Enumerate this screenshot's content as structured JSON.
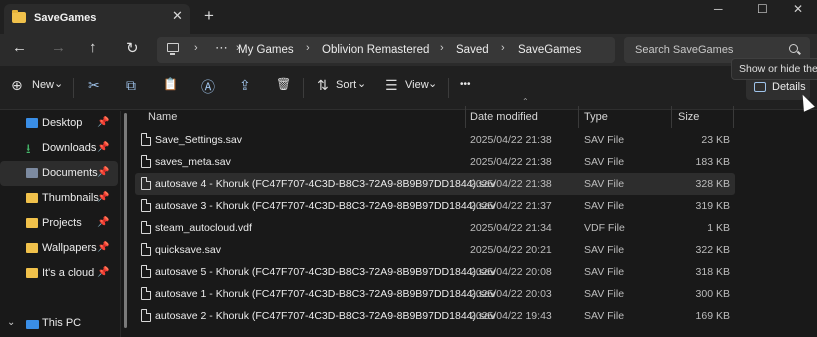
{
  "tab": {
    "title": "SaveGames",
    "close": "✕",
    "new_tab": "+"
  },
  "window": {
    "minimize": "─",
    "maximize": "☐",
    "close": "✕"
  },
  "nav": {
    "back": "←",
    "forward": "→",
    "up": "↑",
    "refresh": "↻"
  },
  "address": {
    "sep": "›",
    "dots": "⋯",
    "breadcrumbs": [
      "My Games",
      "Oblivion Remastered",
      "Saved",
      "SaveGames"
    ]
  },
  "search": {
    "placeholder": "Search SaveGames"
  },
  "commandbar": {
    "new_label": "New",
    "new_icon": "⊕",
    "dropdown": "⌄",
    "cut_icon": "✂",
    "copy_icon": "⧉",
    "paste_icon": "📋",
    "rename_icon": "Ⓐ",
    "share_icon": "⇪",
    "delete_icon": "🗑",
    "sort_icon": "⇅",
    "sort_label": "Sort",
    "view_icon": "☰",
    "view_label": "View",
    "more_icon": "•••",
    "details_label": "Details",
    "tooltip": "Show or hide the d"
  },
  "sidebar": {
    "pin": "📌",
    "items": [
      {
        "label": "Desktop",
        "icon": "desktop-icon",
        "pinned": true
      },
      {
        "label": "Downloads",
        "icon": "download-icon",
        "glyph": "⭳",
        "pinned": true
      },
      {
        "label": "Documents",
        "icon": "documents-icon",
        "pinned": true,
        "active": true
      },
      {
        "label": "Thumbnails",
        "icon": "folder-icon",
        "pinned": true
      },
      {
        "label": "Projects",
        "icon": "folder-icon",
        "pinned": true
      },
      {
        "label": "Wallpapers",
        "icon": "folder-icon",
        "pinned": true
      },
      {
        "label": "It's a cloud",
        "icon": "folder-icon",
        "pinned": true
      }
    ],
    "this_pc": {
      "label": "This PC",
      "chevron": "⌄"
    }
  },
  "list": {
    "sort_arrow": "⌃",
    "columns": [
      "Name",
      "Date modified",
      "Type",
      "Size"
    ],
    "files": [
      {
        "name": "Save_Settings.sav",
        "date": "2025/04/22 21:38",
        "type": "SAV File",
        "size": "23 KB"
      },
      {
        "name": "saves_meta.sav",
        "date": "2025/04/22 21:38",
        "type": "SAV File",
        "size": "183 KB"
      },
      {
        "name": "autosave 4 - Khoruk (FC47F707-4C3D-B8C3-72A9-8B9B97DD1844).sav",
        "date": "2025/04/22 21:38",
        "type": "SAV File",
        "size": "328 KB",
        "hover": true
      },
      {
        "name": "autosave 3 - Khoruk (FC47F707-4C3D-B8C3-72A9-8B9B97DD1844).sav",
        "date": "2025/04/22 21:37",
        "type": "SAV File",
        "size": "319 KB"
      },
      {
        "name": "steam_autocloud.vdf",
        "date": "2025/04/22 21:34",
        "type": "VDF File",
        "size": "1 KB"
      },
      {
        "name": "quicksave.sav",
        "date": "2025/04/22 20:21",
        "type": "SAV File",
        "size": "322 KB"
      },
      {
        "name": "autosave 5 - Khoruk (FC47F707-4C3D-B8C3-72A9-8B9B97DD1844).sav",
        "date": "2025/04/22 20:08",
        "type": "SAV File",
        "size": "318 KB"
      },
      {
        "name": "autosave 1 - Khoruk (FC47F707-4C3D-B8C3-72A9-8B9B97DD1844).sav",
        "date": "2025/04/22 20:03",
        "type": "SAV File",
        "size": "300 KB"
      },
      {
        "name": "autosave 2 - Khoruk (FC47F707-4C3D-B8C3-72A9-8B9B97DD1844).sav",
        "date": "2025/04/22 19:43",
        "type": "SAV File",
        "size": "169 KB"
      }
    ]
  },
  "colors": {
    "accent": "#9fc3ea",
    "folder": "#f0c14b",
    "background": "#191919"
  }
}
